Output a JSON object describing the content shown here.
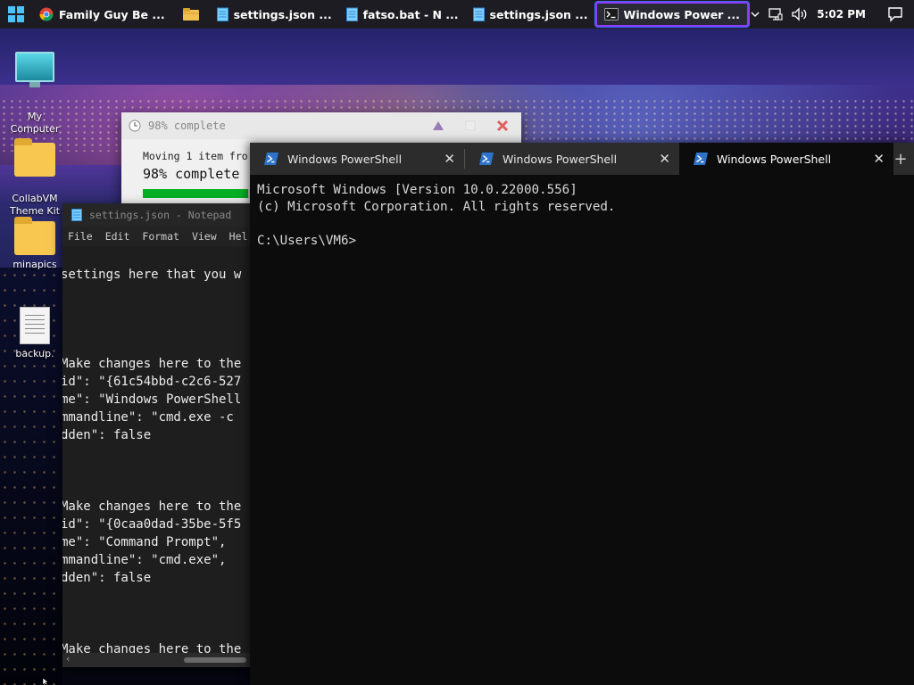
{
  "taskbar": {
    "tasks": [
      {
        "label": "Family Guy Be ...",
        "icon": "chrome-icon"
      },
      {
        "label": "",
        "icon": "file-explorer-icon"
      },
      {
        "label": "settings.json ...",
        "icon": "notepad-icon"
      },
      {
        "label": "fatso.bat - N ...",
        "icon": "notepad-icon"
      },
      {
        "label": "settings.json ...",
        "icon": "notepad-icon"
      },
      {
        "label": "Windows Power ...",
        "icon": "terminal-icon"
      }
    ],
    "time": "5:02 PM"
  },
  "desktop": {
    "icons": [
      {
        "label": "My\nComputer",
        "icon": "monitor-icon"
      },
      {
        "label": "CollabVM\nTheme Kit",
        "icon": "folder-icon"
      },
      {
        "label": "minapics",
        "icon": "folder-icon"
      },
      {
        "label": "backup.",
        "icon": "document-icon"
      }
    ]
  },
  "copy_dialog": {
    "title": "98% complete",
    "status_line": "Moving 1 item fro",
    "percent_text": "98% complete",
    "progress": 0.98
  },
  "notepad": {
    "title": "settings.json - Notepad",
    "menu": [
      "File",
      "Edit",
      "Format",
      "View",
      "Hel"
    ],
    "lines": [
      "settings here that you w",
      "",
      "",
      "",
      "",
      "Make changes here to the",
      "id\": \"{61c54bbd-c2c6-527",
      "me\": \"Windows PowerShell",
      "mmandline\": \"cmd.exe -c",
      "dden\": false",
      "",
      "",
      "",
      "Make changes here to the",
      "id\": \"{0caa0dad-35be-5f5",
      "me\": \"Command Prompt\",",
      "mmandline\": \"cmd.exe\",",
      "dden\": false",
      "",
      "",
      "",
      "Make changes here to the"
    ]
  },
  "terminal": {
    "tabs": [
      {
        "label": "Windows PowerShell"
      },
      {
        "label": "Windows PowerShell"
      },
      {
        "label": "Windows PowerShell"
      }
    ],
    "new_tab": "+",
    "output": "Microsoft Windows [Version 10.0.22000.556]\n(c) Microsoft Corporation. All rights reserved.\n\nC:\\Users\\VM6>"
  },
  "colors": {
    "taskbar_bg": "#1c1c22",
    "active_task_border": "#8a3cff",
    "terminal_bg": "#0c0c0c",
    "progress_fill": "#06b025"
  }
}
